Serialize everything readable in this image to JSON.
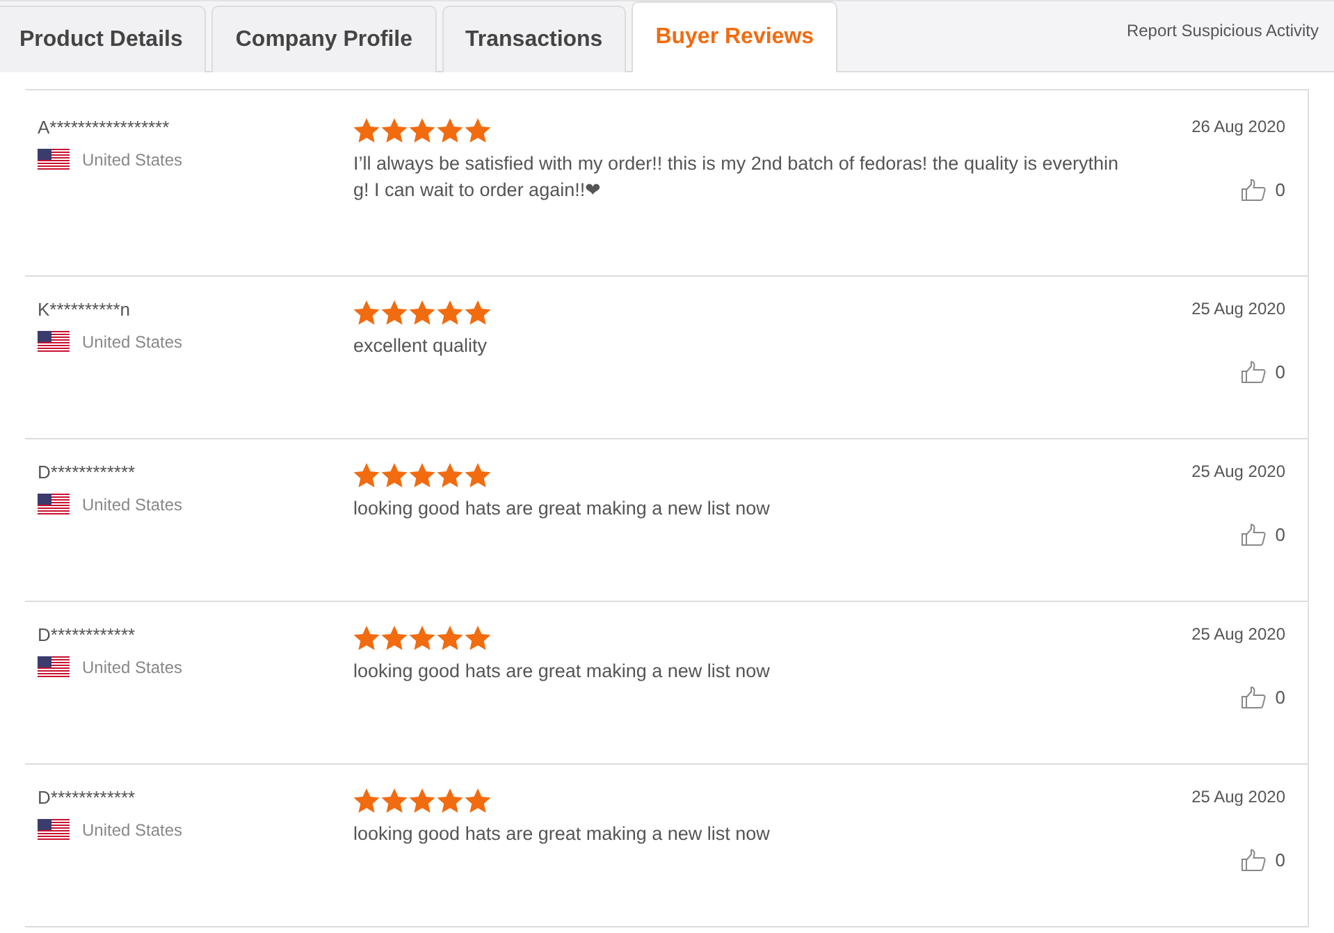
{
  "tabs": [
    {
      "label": "Product Details",
      "selected": false
    },
    {
      "label": "Company Profile",
      "selected": false
    },
    {
      "label": "Transactions",
      "selected": false
    },
    {
      "label": "Buyer Reviews",
      "selected": true
    }
  ],
  "report_link": "Report Suspicious Activity",
  "reviews": [
    {
      "buyer": "A*****************",
      "country": "United States",
      "stars": 5,
      "text": "I’ll always be satisfied with my order!! this is my 2nd batch of fedoras! the quality is everything! I can wait to order again!!❤",
      "date": "26 Aug 2020",
      "likes": "0"
    },
    {
      "buyer": "K**********n",
      "country": "United States",
      "stars": 5,
      "text": "excellent quality",
      "date": "25 Aug 2020",
      "likes": "0"
    },
    {
      "buyer": "D************",
      "country": "United States",
      "stars": 5,
      "text": "looking good hats are great making a new list  now",
      "date": "25 Aug 2020",
      "likes": "0"
    },
    {
      "buyer": "D************",
      "country": "United States",
      "stars": 5,
      "text": "looking good hats are great making a new list  now",
      "date": "25 Aug 2020",
      "likes": "0"
    },
    {
      "buyer": "D************",
      "country": "United States",
      "stars": 5,
      "text": "looking good hats are great making a new list  now",
      "date": "25 Aug 2020",
      "likes": "0"
    }
  ]
}
